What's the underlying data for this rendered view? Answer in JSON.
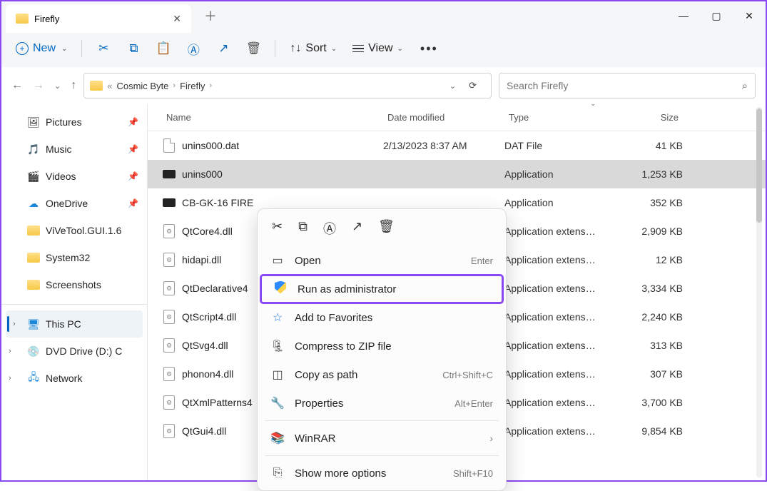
{
  "tab": {
    "title": "Firefly"
  },
  "toolbar": {
    "new_label": "New",
    "sort_label": "Sort",
    "view_label": "View"
  },
  "breadcrumbs": {
    "seg1": "Cosmic Byte",
    "seg2": "Firefly"
  },
  "search": {
    "placeholder": "Search Firefly"
  },
  "columns": {
    "name": "Name",
    "date": "Date modified",
    "type": "Type",
    "size": "Size"
  },
  "sidebar": {
    "pictures": "Pictures",
    "music": "Music",
    "videos": "Videos",
    "onedrive": "OneDrive",
    "vivetool": "ViVeTool.GUI.1.6",
    "system32": "System32",
    "screenshots": "Screenshots",
    "thispc": "This PC",
    "dvd": "DVD Drive (D:) C",
    "network": "Network"
  },
  "files": [
    {
      "name": "unins000.dat",
      "date": "2/13/2023 8:37 AM",
      "type": "DAT File",
      "size": "41 KB",
      "icon": "file"
    },
    {
      "name": "unins000",
      "date": "",
      "type": "Application",
      "size": "1,253 KB",
      "icon": "exe",
      "selected": true
    },
    {
      "name": "CB-GK-16 FIRE",
      "date": "",
      "type": "Application",
      "size": "352 KB",
      "icon": "exe"
    },
    {
      "name": "QtCore4.dll",
      "date": "",
      "type": "Application extens…",
      "size": "2,909 KB",
      "icon": "dll"
    },
    {
      "name": "hidapi.dll",
      "date": "",
      "type": "Application extens…",
      "size": "12 KB",
      "icon": "dll"
    },
    {
      "name": "QtDeclarative4",
      "date": "",
      "type": "Application extens…",
      "size": "3,334 KB",
      "icon": "dll"
    },
    {
      "name": "QtScript4.dll",
      "date": "",
      "type": "Application extens…",
      "size": "2,240 KB",
      "icon": "dll"
    },
    {
      "name": "QtSvg4.dll",
      "date": "",
      "type": "Application extens…",
      "size": "313 KB",
      "icon": "dll"
    },
    {
      "name": "phonon4.dll",
      "date": "",
      "type": "Application extens…",
      "size": "307 KB",
      "icon": "dll"
    },
    {
      "name": "QtXmlPatterns4",
      "date": "",
      "type": "Application extens…",
      "size": "3,700 KB",
      "icon": "dll"
    },
    {
      "name": "QtGui4.dll",
      "date": "",
      "type": "Application extens…",
      "size": "9,854 KB",
      "icon": "dll"
    }
  ],
  "context_menu": {
    "open": "Open",
    "open_sc": "Enter",
    "run_admin": "Run as administrator",
    "favorites": "Add to Favorites",
    "compress": "Compress to ZIP file",
    "copy_path": "Copy as path",
    "copy_path_sc": "Ctrl+Shift+C",
    "properties": "Properties",
    "properties_sc": "Alt+Enter",
    "winrar": "WinRAR",
    "more": "Show more options",
    "more_sc": "Shift+F10"
  }
}
